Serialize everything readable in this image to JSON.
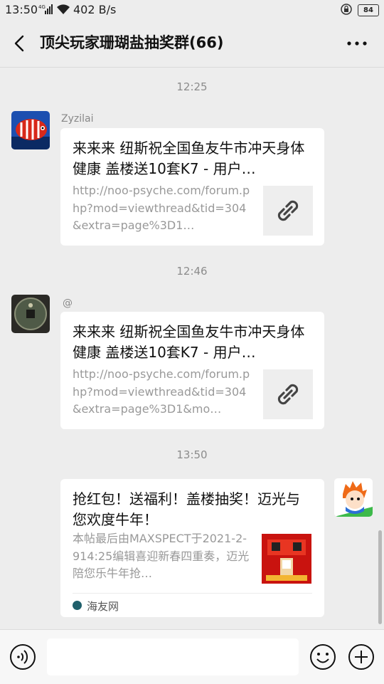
{
  "status_bar": {
    "time": "13:50",
    "network": "4G",
    "speed": "402 B/s",
    "battery": "84"
  },
  "header": {
    "title": "顶尖玩家珊瑚盐抽奖群(66)"
  },
  "messages": [
    {
      "timestamp": "12:25",
      "sender": "Zyzilai",
      "side": "left",
      "title": "来来来 纽斯祝全国鱼友牛市冲天身体健康 盖楼送10套K7 - 用户…",
      "desc": "http://noo-psyche.com/forum.php?mod=viewthread&tid=304&extra=page%3D1…",
      "thumb_icon": "link-icon"
    },
    {
      "timestamp": "12:46",
      "sender": "@",
      "side": "left",
      "title": "来来来 纽斯祝全国鱼友牛市冲天身体健康 盖楼送10套K7 - 用户…",
      "desc": "http://noo-psyche.com/forum.php?mod=viewthread&tid=304&extra=page%3D1&mo…",
      "thumb_icon": "link-icon"
    },
    {
      "timestamp": "13:50",
      "side": "right",
      "title": "抢红包！送福利！盖楼抽奖！迈光与您欢度牛年！",
      "desc": "本帖最后由MAXSPECT于2021-2-914:25编辑喜迎新春四重奏，迈光陪您乐牛年抢…",
      "source": "海友网"
    }
  ],
  "input_bar": {
    "voice_icon": "voice-icon",
    "emoji_icon": "emoji-icon",
    "plus_icon": "plus-icon"
  },
  "colors": {
    "background": "#ededed",
    "card": "#ffffff",
    "muted_text": "#999999"
  }
}
